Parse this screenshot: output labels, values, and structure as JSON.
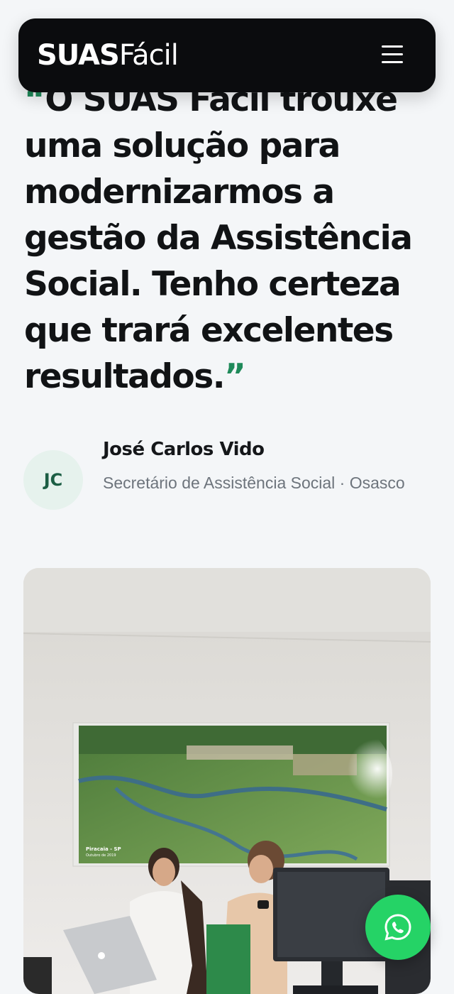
{
  "header": {
    "logo_bold": "SUAS",
    "logo_light": "Fácil",
    "menu_icon": "hamburger-menu-icon"
  },
  "testimonial": {
    "quote_lines": [
      "O SUAS Fácil trouxe",
      "uma solução para",
      "modernizarmos a",
      "gestão da Assistência",
      "Social. Tenho certeza",
      "que trará excelentes",
      "resultados."
    ],
    "open_mark": "“",
    "close_mark": "”",
    "accent_color": "#1f8a5a"
  },
  "author": {
    "initials": "JC",
    "name": "José Carlos Vido",
    "role": "Secretário de Assistência Social · Osasco"
  },
  "photo": {
    "poster_caption_1": "Piracaia - SP",
    "poster_caption_2": "Outubro de 2019"
  },
  "whatsapp": {
    "icon": "whatsapp-icon",
    "color": "#25d366"
  }
}
